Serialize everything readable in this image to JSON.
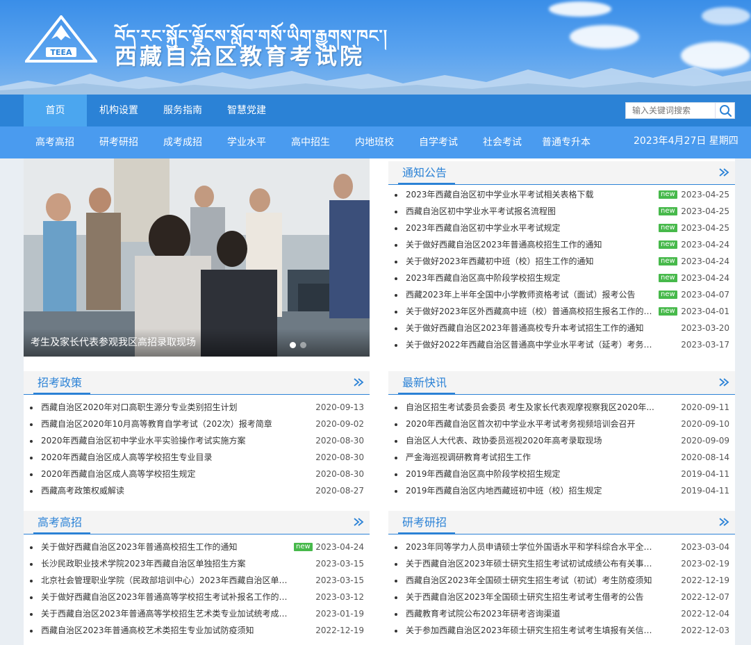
{
  "header": {
    "title_tibetan": "བོད་རང་སྐྱོང་ལྗོངས་སློབ་གསོ་ཡིག་རྒྱུགས་ཁང་།",
    "title_cn": "西藏自治区教育考试院",
    "logo_text": "TEEA"
  },
  "topnav": {
    "items": [
      "首页",
      "机构设置",
      "服务指南",
      "智慧党建"
    ],
    "search_placeholder": "输入关键词搜索"
  },
  "subnav": {
    "items": [
      "高考高招",
      "研考研招",
      "成考成招",
      "学业水平",
      "高中招生",
      "内地班校",
      "自学考试",
      "社会考试",
      "普通专升本"
    ],
    "date": "2023年4月27日 星期四"
  },
  "slider": {
    "caption": "考生及家长代表参观我区高招录取现场"
  },
  "new_badge": "new",
  "notices": {
    "title": "通知公告",
    "items": [
      {
        "title": "2023年西藏自治区初中学业水平考试相关表格下载",
        "date": "2023-04-25",
        "new": true
      },
      {
        "title": "西藏自治区初中学业水平考试报名流程图",
        "date": "2023-04-25",
        "new": true
      },
      {
        "title": "2023年西藏自治区初中学业水平考试规定",
        "date": "2023-04-25",
        "new": true
      },
      {
        "title": "关于做好西藏自治区2023年普通高校招生工作的通知",
        "date": "2023-04-24",
        "new": true
      },
      {
        "title": "关于做好2023年西藏初中班（校）招生工作的通知",
        "date": "2023-04-24",
        "new": true
      },
      {
        "title": "2023年西藏自治区高中阶段学校招生规定",
        "date": "2023-04-24",
        "new": true
      },
      {
        "title": "西藏2023年上半年全国中小学教师资格考试（面试）报考公告",
        "date": "2023-04-07",
        "new": true
      },
      {
        "title": "关于做好2023年区外西藏高中班（校）普通高校招生报名工作的通知",
        "date": "2023-04-01",
        "new": true
      },
      {
        "title": "关于做好西藏自治区2023年普通高校专升本考试招生工作的通知",
        "date": "2023-03-20",
        "new": false
      },
      {
        "title": "关于做好2022年西藏自治区普通高中学业水平考试（延考）考务工...",
        "date": "2023-03-17",
        "new": false
      }
    ]
  },
  "policy": {
    "title": "招考政策",
    "items": [
      {
        "title": "西藏自治区2020年对口高职生源分专业类别招生计划",
        "date": "2020-09-13"
      },
      {
        "title": "西藏自治区2020年10月高等教育自学考试（202次）报考简章",
        "date": "2020-09-02"
      },
      {
        "title": "2020年西藏自治区初中学业水平实验操作考试实施方案",
        "date": "2020-08-30"
      },
      {
        "title": "2020年西藏自治区成人高等学校招生专业目录",
        "date": "2020-08-30"
      },
      {
        "title": "2020年西藏自治区成人高等学校招生规定",
        "date": "2020-08-30"
      },
      {
        "title": "西藏高考政策权威解读",
        "date": "2020-08-27"
      }
    ]
  },
  "news": {
    "title": "最新快讯",
    "items": [
      {
        "title": "自治区招生考试委员会委员 考生及家长代表观摩视察我区2020年...",
        "date": "2020-09-11"
      },
      {
        "title": "2020年西藏自治区首次初中学业水平考试考务视频培训会召开",
        "date": "2020-09-10"
      },
      {
        "title": "自治区人大代表、政协委员巡视2020年高考录取现场",
        "date": "2020-09-09"
      },
      {
        "title": "严金海巡视调研教育考试招生工作",
        "date": "2020-08-14"
      },
      {
        "title": "2019年西藏自治区高中阶段学校招生规定",
        "date": "2019-04-11"
      },
      {
        "title": "2019年西藏自治区内地西藏班初中班（校）招生规定",
        "date": "2019-04-11"
      }
    ]
  },
  "gaokao": {
    "title": "高考高招",
    "items": [
      {
        "title": "关于做好西藏自治区2023年普通高校招生工作的通知",
        "date": "2023-04-24",
        "new": true
      },
      {
        "title": "长沙民政职业技术学院2023年西藏自治区单独招生方案",
        "date": "2023-03-15",
        "new": false
      },
      {
        "title": "北京社会管理职业学院（民政部培训中心）2023年西藏自治区单独...",
        "date": "2023-03-15",
        "new": false
      },
      {
        "title": "关于做好西藏自治区2023年普通高等学校招生考试补报名工作的通知",
        "date": "2023-03-12",
        "new": false
      },
      {
        "title": "关于西藏自治区2023年普通高等学校招生艺术类专业加试统考成绩...",
        "date": "2023-01-19",
        "new": false
      },
      {
        "title": "西藏自治区2023年普通高校艺术类招生专业加试防疫须知",
        "date": "2022-12-19",
        "new": false
      }
    ]
  },
  "yankao": {
    "title": "研考研招",
    "items": [
      {
        "title": "2023年同等学力人员申请硕士学位外国语水平和学科综合水平全国...",
        "date": "2023-03-04"
      },
      {
        "title": "关于西藏自治区2023年硕士研究生招生考试初试成绩公布有关事宜...",
        "date": "2023-02-19"
      },
      {
        "title": "西藏自治区2023年全国硕士研究生招生考试（初试）考生防疫须知",
        "date": "2022-12-19"
      },
      {
        "title": "关于西藏自治区2023年全国硕士研究生招生考试考生借考的公告",
        "date": "2022-12-07"
      },
      {
        "title": "西藏教育考试院公布2023年研考咨询渠道",
        "date": "2022-12-04"
      },
      {
        "title": "关于参加西藏自治区2023年硕士研究生招生考试考生填报有关信息...",
        "date": "2022-12-03"
      }
    ]
  }
}
